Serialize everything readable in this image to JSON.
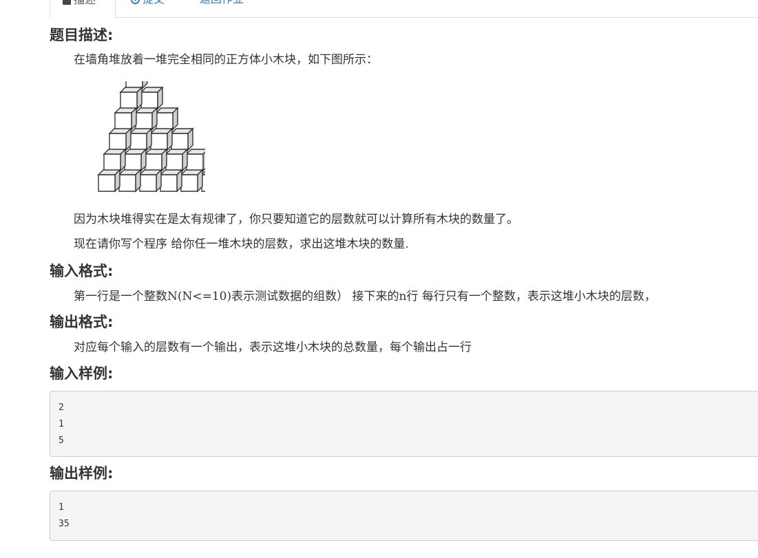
{
  "tabs": [
    {
      "label": "描述",
      "icon": "document-icon",
      "active": true
    },
    {
      "label": "提交",
      "icon": "upload-circle-icon",
      "active": false
    },
    {
      "label": "返回作业",
      "icon": "",
      "active": false
    }
  ],
  "sections": {
    "description": {
      "heading": "题目描述:",
      "para1": "在墙角堆放着一堆完全相同的正方体小木块，如下图所示：",
      "para2": "因为木块堆得实在是太有规律了，你只要知道它的层数就可以计算所有木块的数量了。",
      "para3": "现在请你写个程序 给你任一堆木块的层数，求出这堆木块的数量."
    },
    "input_format": {
      "heading": "输入格式:",
      "text": "第一行是一个整数N(N<=10)表示测试数据的组数） 接下来的n行 每行只有一个整数，表示这堆小木块的层数，"
    },
    "output_format": {
      "heading": "输出格式:",
      "text": "对应每个输入的层数有一个输出，表示这堆小木块的总数量，每个输出占一行"
    },
    "input_sample": {
      "heading": "输入样例:",
      "lines": [
        "2",
        "1",
        "5"
      ]
    },
    "output_sample": {
      "heading": "输出样例:",
      "lines": [
        "1",
        "35"
      ]
    }
  },
  "colors": {
    "link": "#337ab7",
    "text": "#333333",
    "code_bg": "#f5f5f5"
  }
}
